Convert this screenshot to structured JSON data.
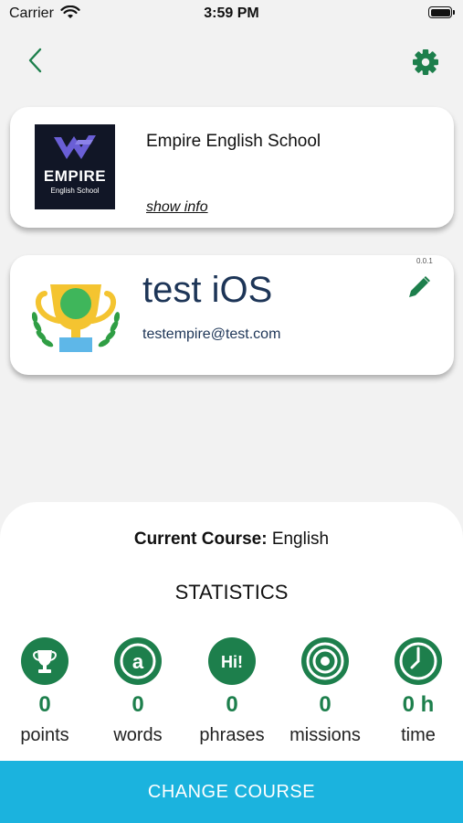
{
  "status_bar": {
    "carrier": "Carrier",
    "time": "3:59 PM"
  },
  "colors": {
    "accent": "#1d7f4c",
    "button": "#1bb3de",
    "user_text": "#1d3557"
  },
  "school": {
    "name": "Empire English School",
    "show_info": "show info",
    "logo_word": "EMPIRE",
    "logo_sub": "English School"
  },
  "profile": {
    "name": "test iOS",
    "email": "testempire@test.com",
    "version": "0.0.1"
  },
  "course": {
    "label": "Current Course:",
    "value": "English"
  },
  "statistics": {
    "title": "STATISTICS",
    "items": [
      {
        "icon": "trophy-icon",
        "value": "0",
        "label": "points"
      },
      {
        "icon": "at-sign-icon",
        "value": "0",
        "label": "words"
      },
      {
        "icon": "speech-bubble-icon",
        "value": "0",
        "label": "phrases"
      },
      {
        "icon": "target-icon",
        "value": "0",
        "label": "missions"
      },
      {
        "icon": "clock-icon",
        "value": "0 h",
        "label": "time"
      }
    ]
  },
  "actions": {
    "change_course": "CHANGE COURSE"
  }
}
